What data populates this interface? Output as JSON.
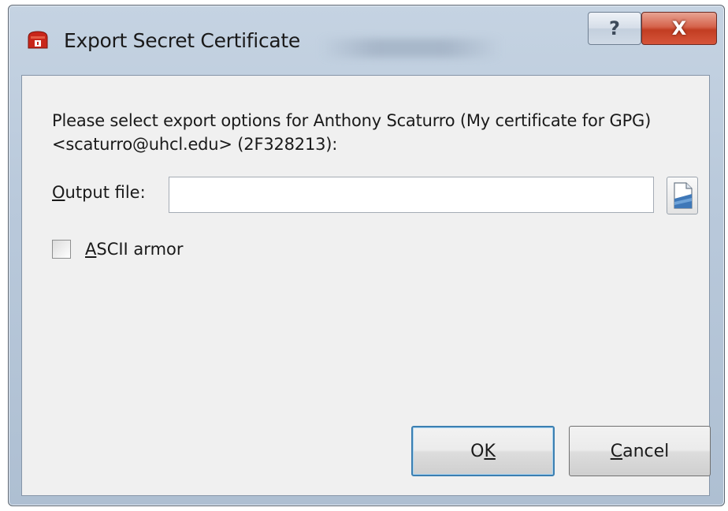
{
  "window": {
    "title": "Export Secret Certificate",
    "help_label": "?",
    "close_label": "X"
  },
  "content": {
    "prompt": "Please select export options for Anthony Scaturro (My certificate for GPG) <scaturro@uhcl.edu> (2F328213):",
    "output_file": {
      "label_mnemonic": "O",
      "label_rest": "utput file:",
      "value": "",
      "placeholder": ""
    },
    "ascii_armor": {
      "label_mnemonic": "A",
      "label_rest": "SCII armor",
      "checked": false
    }
  },
  "buttons": {
    "ok_pre": "O",
    "ok_mnemonic": "K",
    "cancel_mnemonic": "C",
    "cancel_rest": "ancel"
  },
  "colors": {
    "title_bar": "#b9c9db",
    "close_button": "#c23d22",
    "dialog_body": "#f0f0f0",
    "default_button_border": "#3c7fb1"
  },
  "icons": {
    "app": "gpg-app-icon",
    "browse": "open-file-icon"
  }
}
